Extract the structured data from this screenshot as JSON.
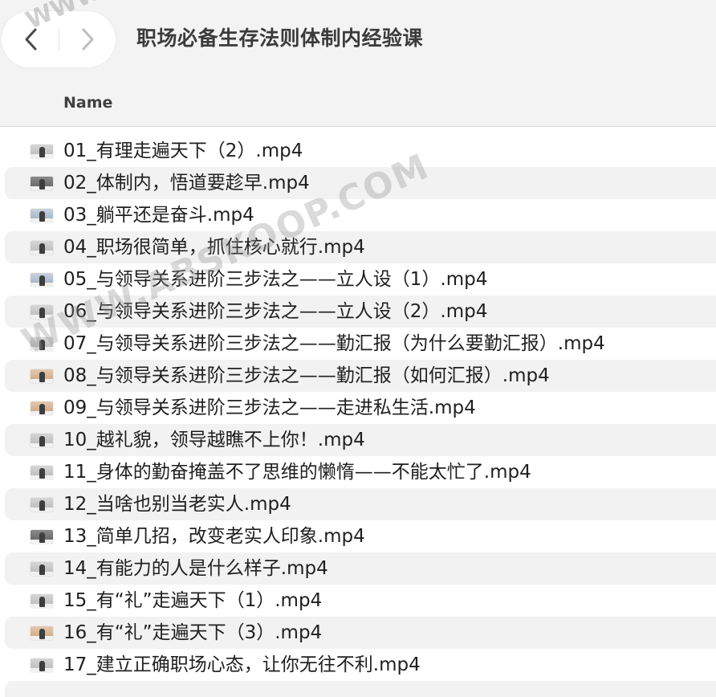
{
  "window": {
    "title": "职场必备生存法则体制内经验课"
  },
  "columns": {
    "name_label": "Name"
  },
  "files": [
    {
      "name": "01_有理走遍天下（2）.mp4",
      "thumb": "light"
    },
    {
      "name": "02_体制内，悟道要趁早.mp4",
      "thumb": "dark"
    },
    {
      "name": "03_躺平还是奋斗.mp4",
      "thumb": "blue"
    },
    {
      "name": "04_职场很简单，抓住核心就行.mp4",
      "thumb": "light"
    },
    {
      "name": "05_与领导关系进阶三步法之——立人设（1）.mp4",
      "thumb": "blue"
    },
    {
      "name": "06_与领导关系进阶三步法之——立人设（2）.mp4",
      "thumb": "light"
    },
    {
      "name": "07_与领导关系进阶三步法之——勤汇报（为什么要勤汇报）.mp4",
      "thumb": "light"
    },
    {
      "name": "08_与领导关系进阶三步法之——勤汇报（如何汇报）.mp4",
      "thumb": "warm"
    },
    {
      "name": "09_与领导关系进阶三步法之——走进私生活.mp4",
      "thumb": "warm"
    },
    {
      "name": "10_越礼貌，领导越瞧不上你！.mp4",
      "thumb": "light"
    },
    {
      "name": "11_身体的勤奋掩盖不了思维的懒惰——不能太忙了.mp4",
      "thumb": "light"
    },
    {
      "name": "12_当啥也别当老实人.mp4",
      "thumb": "light"
    },
    {
      "name": "13_简单几招，改变老实人印象.mp4",
      "thumb": "dark"
    },
    {
      "name": "14_有能力的人是什么样子.mp4",
      "thumb": "light"
    },
    {
      "name": "15_有“礼”走遍天下（1）.mp4",
      "thumb": "light"
    },
    {
      "name": "16_有“礼”走遍天下（3）.mp4",
      "thumb": "warm"
    },
    {
      "name": "17_建立正确职场心态，让你无往不利.mp4",
      "thumb": "light"
    }
  ],
  "watermark": {
    "text": "WWW.ABSKOOP.COM",
    "corner_text": "WWW"
  },
  "icons": {
    "back": "chevron-left-icon",
    "forward": "chevron-right-icon",
    "file_thumb": "video-thumbnail-icon"
  },
  "colors": {
    "toolbar_bg": "#f3f3f3",
    "stripe_bg": "#f2f2f2",
    "text": "#1f1f1f",
    "title": "#3b3b3b"
  }
}
